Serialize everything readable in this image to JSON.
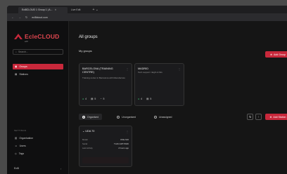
{
  "browser": {
    "tab_title": "Ecl8CLOUD 1 Group 1 | A...",
    "tab_title_2": "Live Edit",
    "url": "ecl8cloud.com"
  },
  "sidebar": {
    "logo_text": "EcleCLOUD",
    "logo_sub": "ecl8",
    "search_placeholder": "Search...",
    "nav": [
      {
        "label": "Groups",
        "active": true
      },
      {
        "label": "Stations",
        "active": false
      }
    ],
    "settings_title": "SETTINGS",
    "settings": [
      {
        "label": "Organisation"
      },
      {
        "label": "Users"
      },
      {
        "label": "Tags"
      }
    ],
    "user": "Ecl8"
  },
  "main": {
    "title": "All groups",
    "my_groups_title": "My groups",
    "add_group_label": "Add Group",
    "groups": [
      {
        "title": "BARCELONA (TRAINING CENTRE)",
        "desc": "Training center in Barcelona with Manufacture",
        "stats": [
          "4",
          "5",
          "5"
        ]
      },
      {
        "title": "MADRID",
        "desc": "Tech support / Eight & Mix",
        "stats": [
          "4",
          "5"
        ]
      }
    ],
    "filters": [
      {
        "label": "Organised",
        "selected": true
      },
      {
        "label": "Unorganised",
        "selected": false
      },
      {
        "label": "Unassigned",
        "selected": false
      }
    ],
    "add_station_label": "Add Station",
    "station": {
      "title": "UDA 70",
      "rows": [
        {
          "k": "Model",
          "v": "ONE-S40"
        },
        {
          "k": "Serial",
          "v": "T1204-WP70930"
        },
        {
          "k": "Last Activity",
          "v": "2 hours ago"
        }
      ]
    }
  },
  "colors": {
    "accent": "#c8283b",
    "background": "#151515",
    "status_green": "#38b36a"
  }
}
